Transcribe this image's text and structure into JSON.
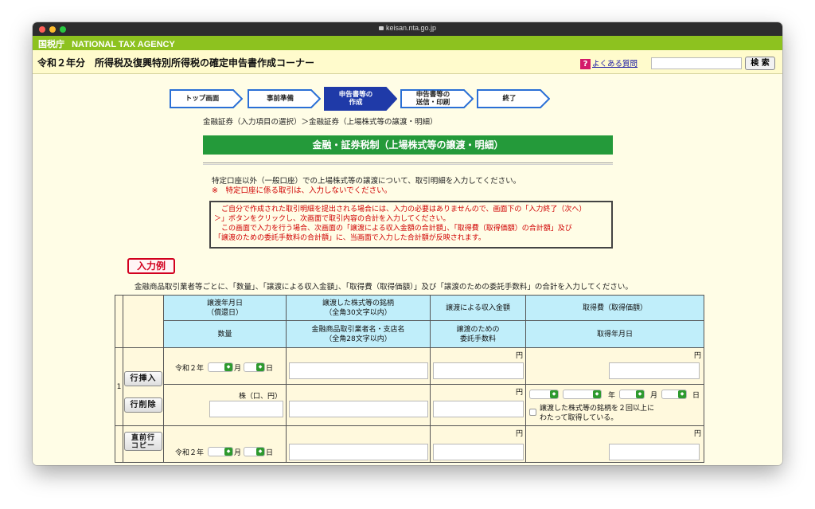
{
  "browser": {
    "url": "keisan.nta.go.jp"
  },
  "agency": {
    "kanji": "国税庁",
    "name": "NATIONAL TAX AGENCY"
  },
  "header": {
    "title": "令和２年分　所得税及復興特別所得税の確定申告書作成コーナー",
    "faq_label": "よくある質問",
    "faq_icon": "?",
    "search_value": "",
    "search_button": "検 索"
  },
  "steps": [
    {
      "label": "トップ画面"
    },
    {
      "label": "事前準備"
    },
    {
      "label_line1": "申告書等の",
      "label_line2": "作成"
    },
    {
      "label_line1": "申告書等の",
      "label_line2": "送信・印刷"
    },
    {
      "label": "終了"
    }
  ],
  "breadcrumb": "金融証券（入力項目の選択）＞金融証券（上場株式等の譲渡・明細）",
  "page_title": "金融・証券税制（上場株式等の譲渡・明細）",
  "intro": {
    "line1": "特定口座以外（一般口座）での上場株式等の譲渡について、取引明細を入力してください。",
    "line2": "※　特定口座に係る取引は、入力しないでください。"
  },
  "notice": [
    "　ご自分で作成された取引明細を提出される場合には、入力の必要はありませんので、画面下の「入力終了（次へ）",
    "＞」ボタンをクリックし、次画面で取引内容の合計を入力してください。",
    "　この画面で入力を行う場合、次画面の「譲渡による収入金額の合計額」、「取得費（取得価額）の合計額」及び",
    "「譲渡のための委託手数料の合計額」に、当画面で入力した合計額が反映されます。"
  ],
  "example_button": "入力例",
  "instruction": "金融商品取引業者等ごとに、「数量」、「譲渡による収入金額」、「取得費（取得価額）」及び「譲渡のための委託手数料」の合計を入力してください。",
  "table": {
    "headers_row1": {
      "date_line1": "譲渡年月日",
      "date_line2": "（償還日）",
      "stock_line1": "譲渡した株式等の銘柄",
      "stock_line2": "（全角30文字以内）",
      "income": "譲渡による収入金額",
      "cost": "取得費（取得価額）"
    },
    "headers_row2": {
      "quantity": "数量",
      "broker_line1": "金融商品取引業者名・支店名",
      "broker_line2": "（全角28文字以内）",
      "fee_line1": "譲渡のための",
      "fee_line2": "委託手数料",
      "acq_date": "取得年月日"
    },
    "row_number": "1",
    "era": "令和２年",
    "month": "月",
    "day": "日",
    "year": "年",
    "yen": "円",
    "unit": "株（口、円）",
    "insert_button": "行挿入",
    "delete_button": "行削除",
    "copy_line1": "直前行",
    "copy_line2": "コピー",
    "twice_line1": "譲渡した株式等の銘柄を２回以上に",
    "twice_line2": "わたって取得している。"
  }
}
